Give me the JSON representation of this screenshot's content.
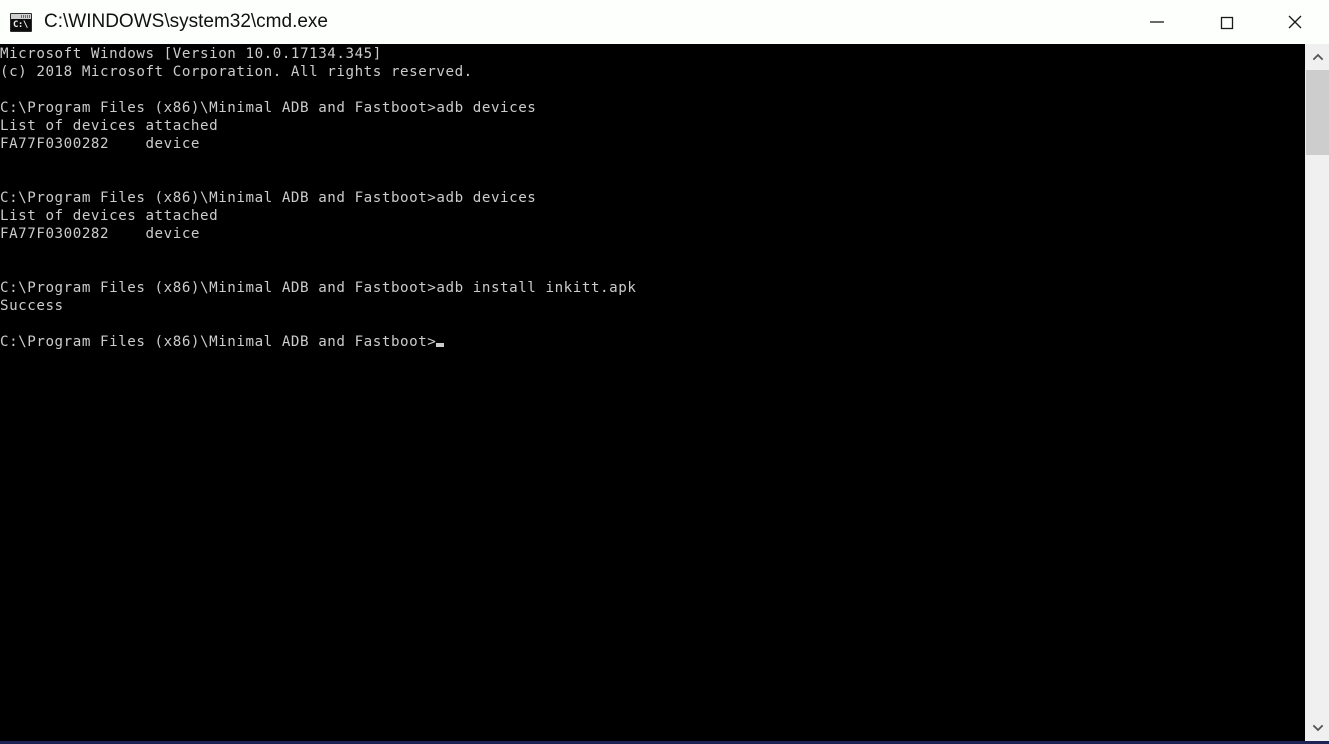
{
  "window": {
    "title": "C:\\WINDOWS\\system32\\cmd.exe",
    "icon_name": "cmd-console-icon",
    "icon_text": "C:\\",
    "titlebar_bg": "#fdfffd",
    "titlebar_text_color": "#111111",
    "border_color": "#1b2453"
  },
  "controls": {
    "minimize_label": "Minimize",
    "maximize_label": "Maximize",
    "close_label": "Close"
  },
  "console": {
    "background": "#000000",
    "foreground": "#cccccc",
    "lines": [
      "Microsoft Windows [Version 10.0.17134.345]",
      "(c) 2018 Microsoft Corporation. All rights reserved.",
      "",
      "C:\\Program Files (x86)\\Minimal ADB and Fastboot>adb devices",
      "List of devices attached",
      "FA77F0300282    device",
      "",
      "",
      "C:\\Program Files (x86)\\Minimal ADB and Fastboot>adb devices",
      "List of devices attached",
      "FA77F0300282    device",
      "",
      "",
      "C:\\Program Files (x86)\\Minimal ADB and Fastboot>adb install inkitt.apk",
      "Success",
      ""
    ],
    "prompt": "C:\\Program Files (x86)\\Minimal ADB and Fastboot>",
    "cursor": "block-cursor"
  },
  "scrollbar": {
    "up_arrow": "chevron-up-icon",
    "down_arrow": "chevron-down-icon",
    "track_color": "#f0f0f0",
    "thumb_color": "#cdcdcd"
  }
}
